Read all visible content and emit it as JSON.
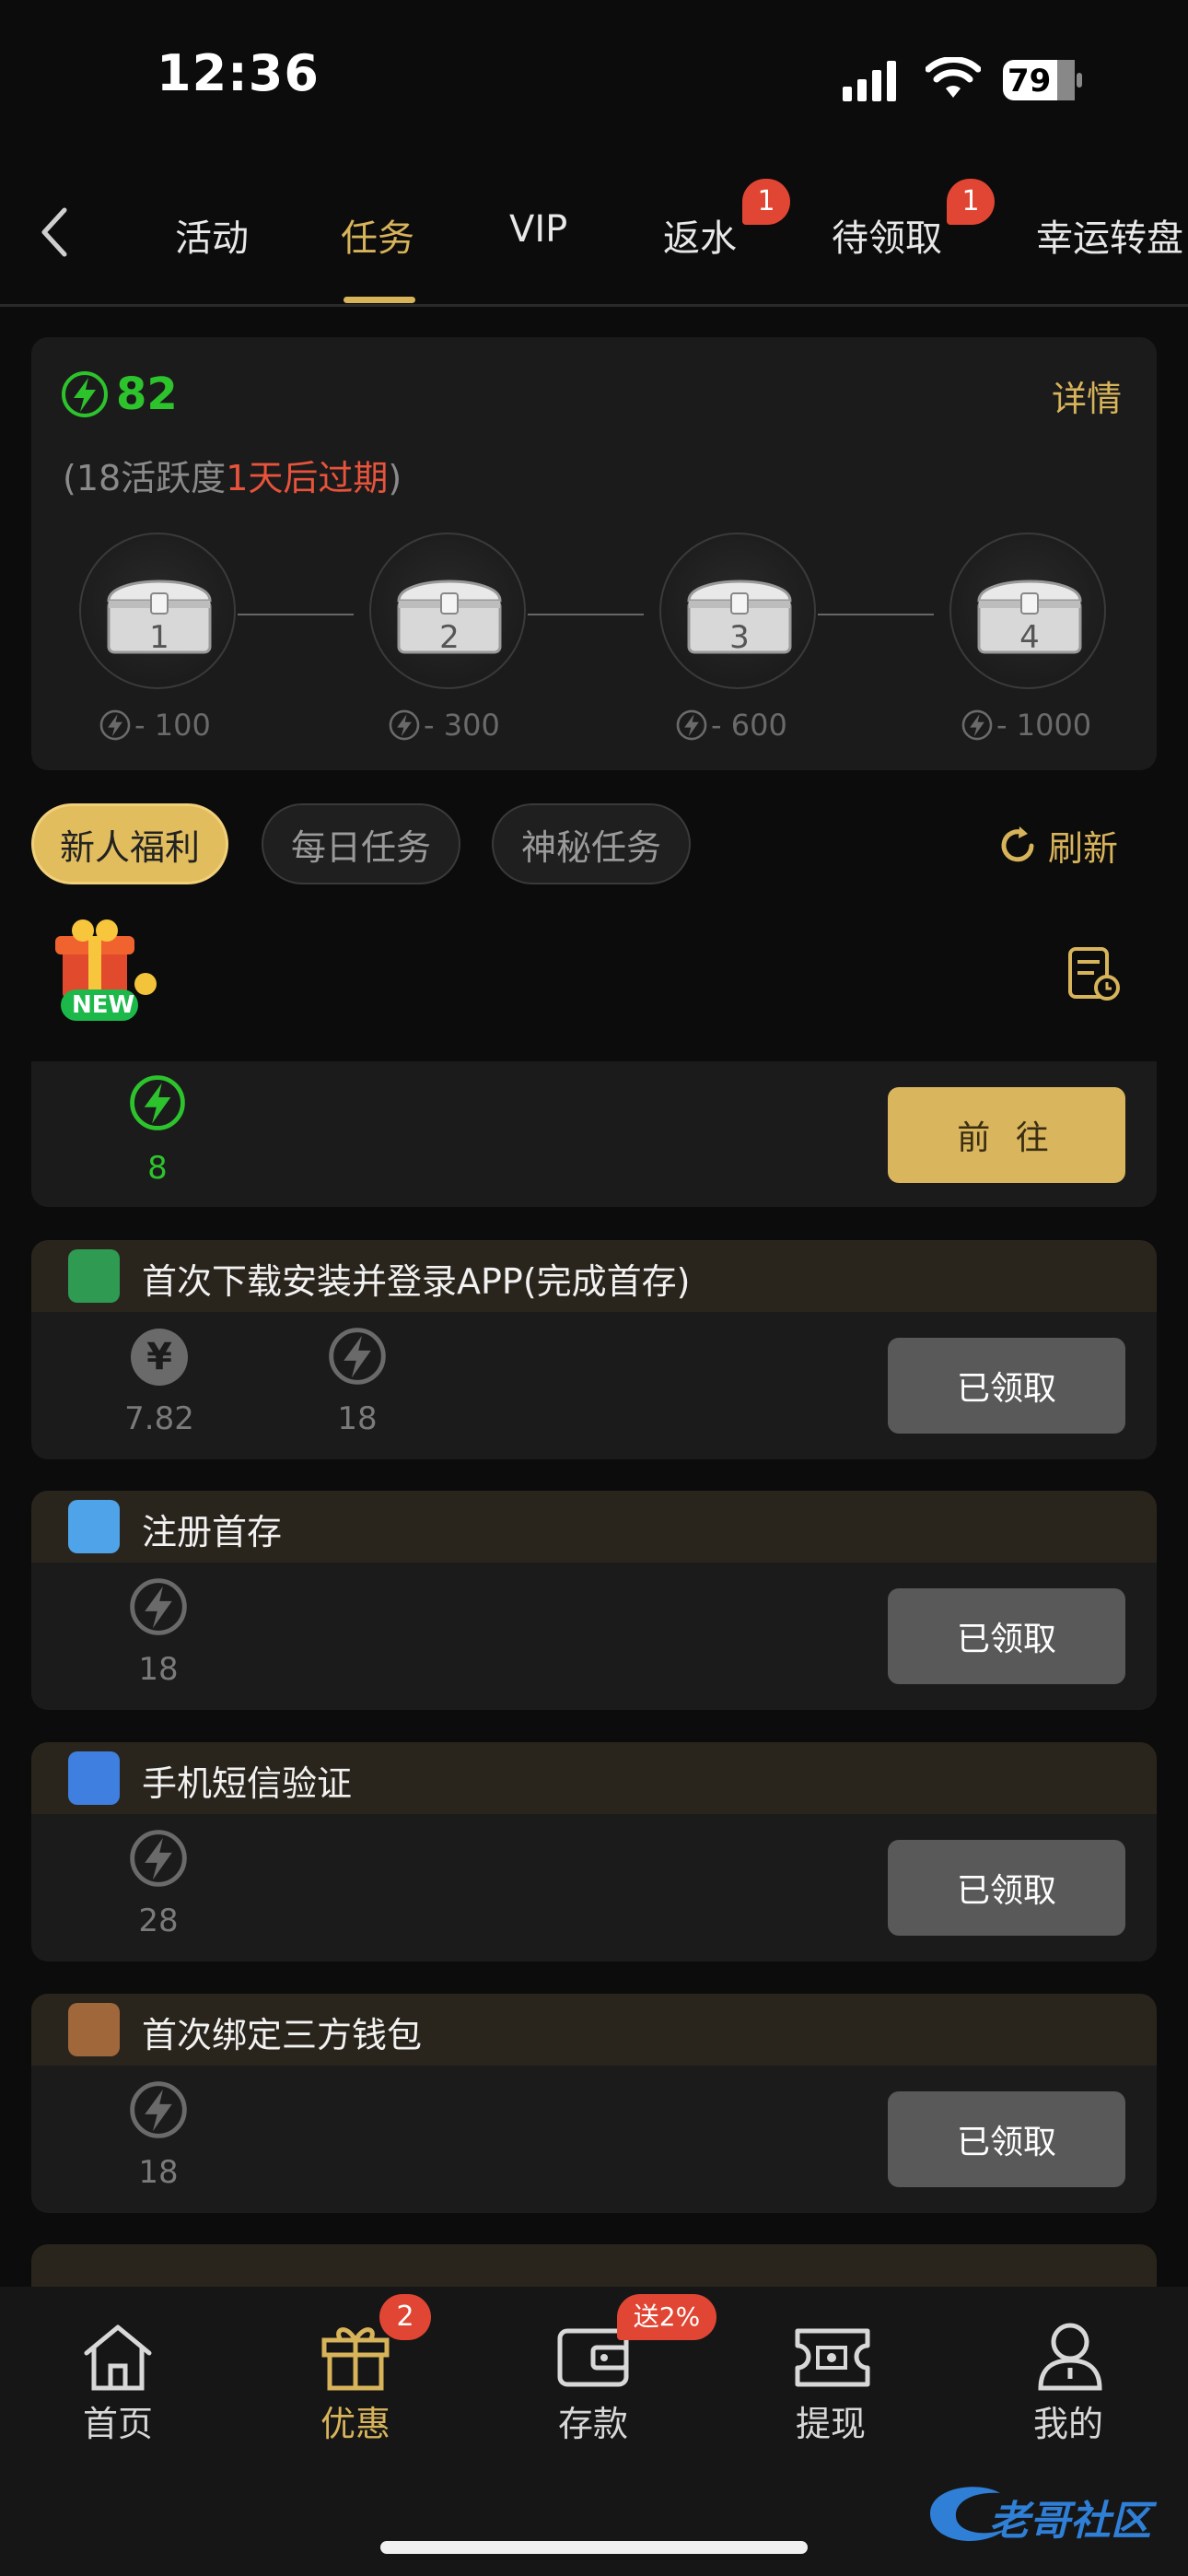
{
  "status_bar": {
    "time": "12:36",
    "battery": "79"
  },
  "nav": {
    "tabs": [
      {
        "label": "活动"
      },
      {
        "label": "任务"
      },
      {
        "label": "VIP"
      },
      {
        "label": "返水",
        "badge": "1"
      },
      {
        "label": "待领取",
        "badge": "1"
      },
      {
        "label": "幸运转盘"
      }
    ],
    "active_tab": "任务"
  },
  "activity": {
    "energy_value": "82",
    "details_label": "详情",
    "sub_open": "(18活跃度",
    "sub_highlight": "1天后过期",
    "sub_close": ")",
    "chests": [
      {
        "number": "1",
        "cost": "- 100"
      },
      {
        "number": "2",
        "cost": "- 300"
      },
      {
        "number": "3",
        "cost": "- 600"
      },
      {
        "number": "4",
        "cost": "- 1000"
      }
    ]
  },
  "filters": {
    "pills": [
      {
        "label": "新人福利",
        "active": true
      },
      {
        "label": "每日任务",
        "active": false
      },
      {
        "label": "神秘任务",
        "active": false
      }
    ],
    "refresh_label": "刷新"
  },
  "new_badge": "NEW",
  "first_task": {
    "energy": "8",
    "button": "前 往"
  },
  "tasks": [
    {
      "title": "首次下载安装并登录APP(完成首存)",
      "money": "7.82",
      "energy": "18",
      "button": "已领取"
    },
    {
      "title": "注册首存",
      "energy": "18",
      "button": "已领取"
    },
    {
      "title": "手机短信验证",
      "energy": "28",
      "button": "已领取"
    },
    {
      "title": "首次绑定三方钱包",
      "energy": "18",
      "button": "已领取"
    }
  ],
  "bottom_nav": {
    "items": [
      {
        "label": "首页",
        "icon": "home-icon"
      },
      {
        "label": "优惠",
        "icon": "gift-icon",
        "badge": "2",
        "active": true
      },
      {
        "label": "存款",
        "icon": "wallet-icon",
        "badge": "送2%"
      },
      {
        "label": "提现",
        "icon": "withdraw-icon"
      },
      {
        "label": "我的",
        "icon": "user-icon"
      }
    ]
  },
  "watermark": "老哥社区",
  "colors": {
    "accent": "#d7b35a",
    "energy": "#2dc32d",
    "badge": "#e04633",
    "warning": "#e8533c"
  }
}
